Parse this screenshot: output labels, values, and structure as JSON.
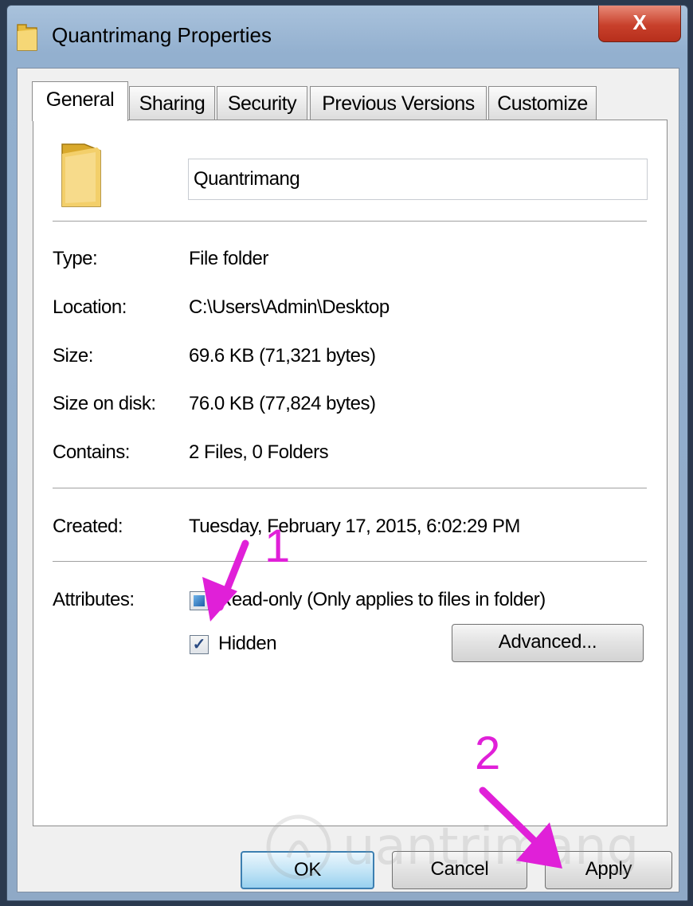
{
  "window": {
    "title": "Quantrimang Properties",
    "close_label": "X"
  },
  "tabs": [
    {
      "label": "General"
    },
    {
      "label": "Sharing"
    },
    {
      "label": "Security"
    },
    {
      "label": "Previous Versions"
    },
    {
      "label": "Customize"
    }
  ],
  "general": {
    "folder_name": "Quantrimang",
    "type_label": "Type:",
    "type_value": "File folder",
    "location_label": "Location:",
    "location_value": "C:\\Users\\Admin\\Desktop",
    "size_label": "Size:",
    "size_value": "69.6 KB (71,321 bytes)",
    "size_on_disk_label": "Size on disk:",
    "size_on_disk_value": "76.0 KB (77,824 bytes)",
    "contains_label": "Contains:",
    "contains_value": "2 Files, 0 Folders",
    "created_label": "Created:",
    "created_value": "Tuesday, February 17, 2015, 6:02:29 PM",
    "attributes_label": "Attributes:",
    "readonly_label": "Read-only (Only applies to files in folder)",
    "readonly_state": "indeterminate",
    "hidden_label": "Hidden",
    "hidden_checked": true,
    "advanced_label": "Advanced..."
  },
  "footer": {
    "ok_label": "OK",
    "cancel_label": "Cancel",
    "apply_label": "Apply"
  },
  "annotations": {
    "step1": "1",
    "step2": "2",
    "color": "#e020d8"
  },
  "icons": {
    "title_icon": "folder-icon",
    "folder_icon": "folder-icon",
    "close_icon": "close-icon"
  }
}
